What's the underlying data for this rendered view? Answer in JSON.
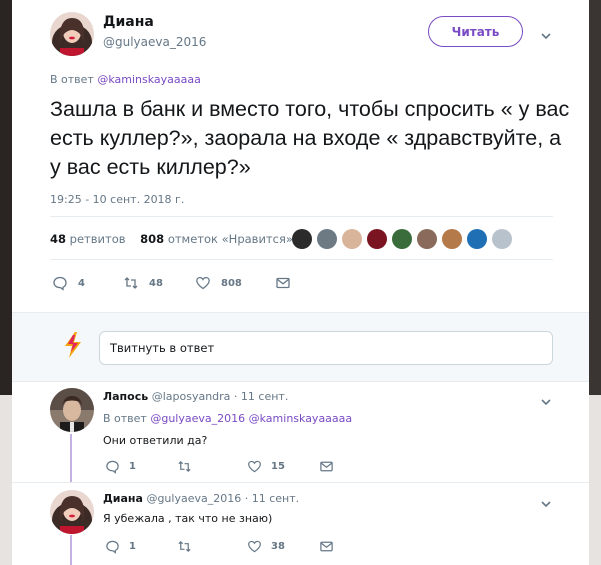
{
  "colors": {
    "accent": "#794bc4",
    "muted": "#657786",
    "text": "#14171a"
  },
  "tweet": {
    "author": {
      "name": "Диана",
      "handle": "@gulyaeva_2016"
    },
    "follow_label": "Читать",
    "reply_prefix": "В ответ",
    "reply_to": "@kaminskayaaaaa",
    "text": "Зашла в банк и вместо того, чтобы спросить « у вас есть куллер?», заорала на входе « здравствуйте, а у вас есть киллер?»",
    "timestamp": "19:25 - 10 сент. 2018 г.",
    "stats": {
      "retweets": "48",
      "retweets_label": "ретвитов",
      "likes": "808",
      "likes_label": "отметок «Нравится»"
    },
    "actions": {
      "replies": "4",
      "retweets": "48",
      "likes": "808"
    }
  },
  "compose": {
    "placeholder": "Твитнуть в ответ"
  },
  "replies": [
    {
      "name": "Лапось",
      "handle": "@laposyandra",
      "time": "· 11 сент.",
      "reply_prefix": "В ответ",
      "reply_to_1": "@gulyaeva_2016",
      "reply_to_2": "@kaminskayaaaaa",
      "text": "Они ответили да?",
      "actions": {
        "replies": "1",
        "retweets": "",
        "likes": "15"
      }
    },
    {
      "name": "Диана",
      "handle": "@gulyaeva_2016",
      "time": "· 11 сент.",
      "text": "Я убежала , так что не знаю)",
      "actions": {
        "replies": "1",
        "retweets": "",
        "likes": "38"
      }
    }
  ]
}
